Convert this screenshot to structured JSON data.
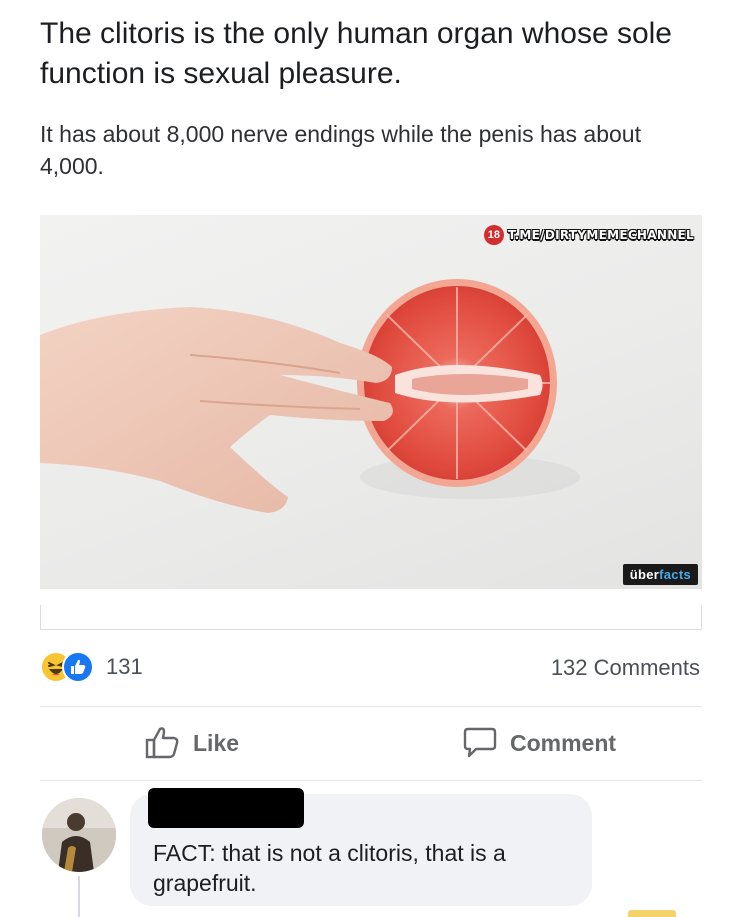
{
  "post": {
    "headline": "The clitoris is the only human organ whose sole function is sexual pleasure.",
    "subtext": "It has about 8,000 nerve endings while the penis has about 4,000."
  },
  "image": {
    "watermark_badge": "18",
    "watermark_text": "T.ME/DIRTYMEMECHANNEL",
    "brand_part1": "über",
    "brand_part2": "facts"
  },
  "stats": {
    "reaction_count": "131",
    "comments_label": "132 Comments"
  },
  "actions": {
    "like_label": "Like",
    "comment_label": "Comment"
  },
  "comment": {
    "text": "FACT: that is not a clitoris, that is a grapefruit."
  },
  "icons": {
    "reaction_haha": "haha-emoji-icon",
    "reaction_like": "thumbs-up-icon",
    "like_action": "thumbs-up-outline-icon",
    "comment_action": "speech-bubble-icon"
  },
  "colors": {
    "like_blue": "#1877f2",
    "haha_yellow": "#f7c531",
    "muted_text": "#65676b",
    "bubble_bg": "#f0f2f5",
    "grapefruit": "#e5473c"
  }
}
